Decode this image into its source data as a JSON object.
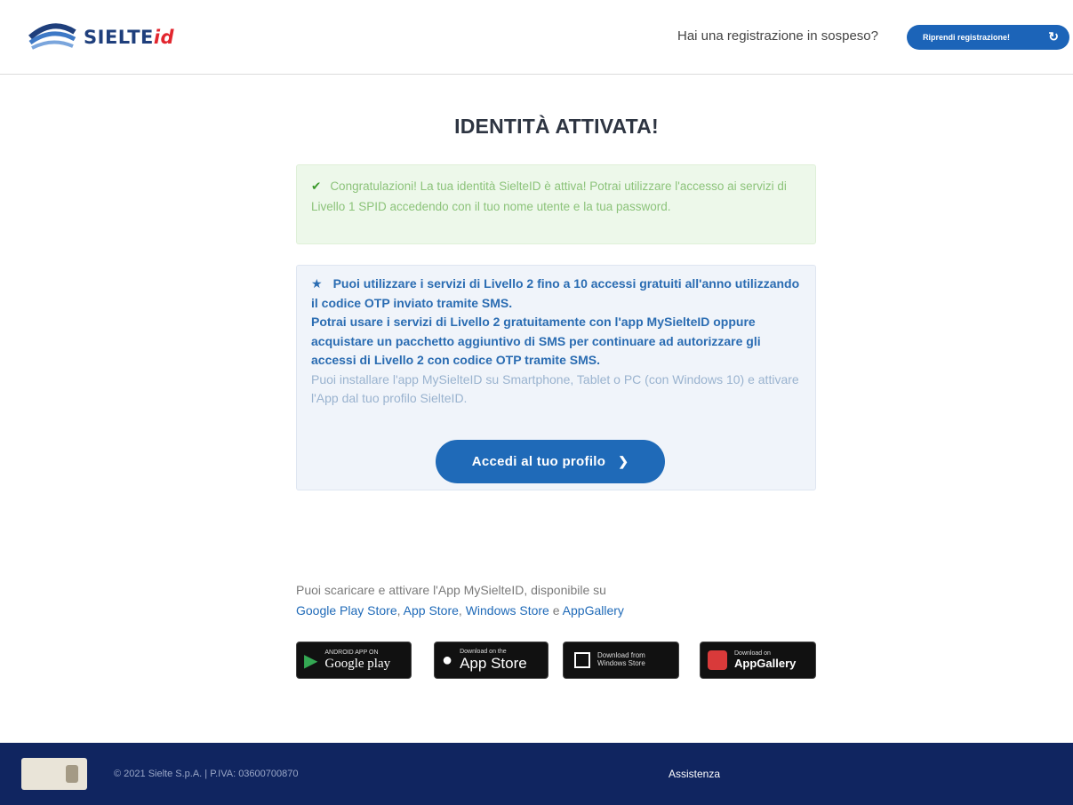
{
  "header": {
    "logo_text": "SIELTE",
    "logo_suffix": "id",
    "pending_text": "Hai una registrazione in sospeso?",
    "resume_label": "Riprendi registrazione!",
    "resume_icon": "↻"
  },
  "title": "IDENTITÀ ATTIVATA!",
  "success": {
    "text": "Congratulazioni! La tua identità SielteID è attiva! Potrai utilizzare l'accesso ai servizi di Livello 1 SPID accedendo con il tuo nome utente e la tua password."
  },
  "info": {
    "line1": "Puoi utilizzare i servizi di Livello 2 fino a 10 accessi gratuiti all'anno utilizzando il codice OTP inviato tramite SMS.",
    "line2": "Potrai usare i servizi di Livello 2 gratuitamente con l'app MySielteID oppure acquistare un pacchetto aggiuntivo di SMS per continuare ad autorizzare gli accessi di Livello 2 con codice OTP tramite SMS.",
    "line3": "Puoi installare l'app MySielteID su Smartphone, Tablet o PC (con Windows 10) e attivare l'App dal tuo profilo SielteID.",
    "button_label": "Accedi al tuo profilo"
  },
  "download": {
    "intro": "Puoi scaricare e attivare l'App MySielteID, disponibile su",
    "google": "Google Play Store",
    "apple": "App Store",
    "windows": "Windows Store",
    "sep_and": "e",
    "huawei": "AppGallery"
  },
  "badges": {
    "gp_small": "ANDROID APP ON",
    "gp_big": "Google play",
    "as_small": "Download on the",
    "as_big": "App Store",
    "ws_small": "Download from",
    "ws_big": "Windows Store",
    "ag_small": "Download on",
    "ag_big": "AppGallery"
  },
  "footer": {
    "copyright": "© 2021 Sielte S.p.A. | P.IVA: 03600700870",
    "assist": "Assistenza"
  },
  "colors": {
    "primary": "#1f6ab8",
    "footer_bg": "#102560",
    "success_bg": "#edf8ea",
    "info_bg": "#f0f4fa"
  }
}
